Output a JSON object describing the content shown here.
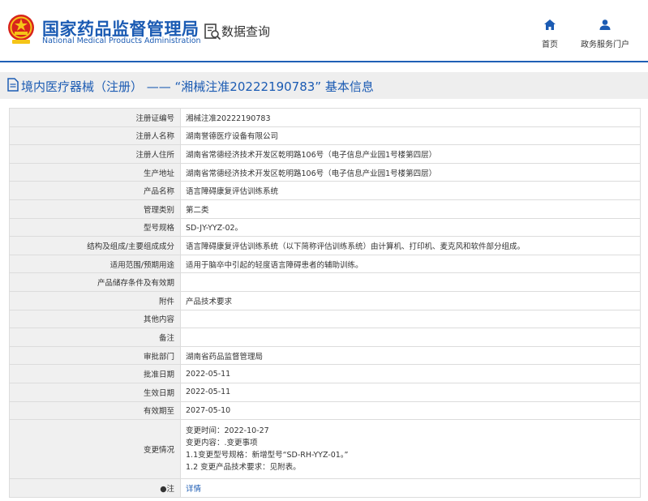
{
  "header": {
    "brand_cn": "国家药品监督管理局",
    "brand_en": "National Medical Products Administration",
    "query_label": "数据查询",
    "nav": [
      {
        "label": "首页",
        "icon": "home-icon"
      },
      {
        "label": "政务服务门户",
        "icon": "user-icon"
      }
    ],
    "accent_color": "#1b5bb3"
  },
  "title": {
    "icon": "document-icon",
    "text": "境内医疗器械（注册） —— “湘械注准20222190783” 基本信息"
  },
  "rows": [
    {
      "label": "注册证编号",
      "value": "湘械注准20222190783"
    },
    {
      "label": "注册人名称",
      "value": "湖南誉德医疗设备有限公司"
    },
    {
      "label": "注册人住所",
      "value": "湖南省常德经济技术开发区乾明路106号（电子信息产业园1号楼第四层）"
    },
    {
      "label": "生产地址",
      "value": "湖南省常德经济技术开发区乾明路106号（电子信息产业园1号楼第四层）"
    },
    {
      "label": "产品名称",
      "value": "语言障碍康复评估训练系统"
    },
    {
      "label": "管理类别",
      "value": "第二类"
    },
    {
      "label": "型号规格",
      "value": "SD-JY-YYZ-02。"
    },
    {
      "label": "结构及组成/主要组成成分",
      "value": "语言障碍康复评估训练系统（以下简称评估训练系统）由计算机、打印机、麦克风和软件部分组成。"
    },
    {
      "label": "适用范围/预期用途",
      "value": "适用于脑卒中引起的轻度语言障碍患者的辅助训练。"
    },
    {
      "label": "产品储存条件及有效期",
      "value": ""
    },
    {
      "label": "附件",
      "value": "产品技术要求"
    },
    {
      "label": "其他内容",
      "value": ""
    },
    {
      "label": "备注",
      "value": ""
    },
    {
      "label": "审批部门",
      "value": "湖南省药品监督管理局"
    },
    {
      "label": "批准日期",
      "value": "2022-05-11"
    },
    {
      "label": "生效日期",
      "value": "2022-05-11"
    },
    {
      "label": "有效期至",
      "value": "2027-05-10"
    }
  ],
  "change": {
    "label": "变更情况",
    "lines": [
      "变更时间：2022-10-27",
      "变更内容：.变更事项",
      "1.1变更型号规格：新增型号“SD-RH-YYZ-01。”",
      "1.2 变更产品技术要求：见附表。"
    ]
  },
  "note": {
    "label": "注",
    "link": "详情"
  }
}
